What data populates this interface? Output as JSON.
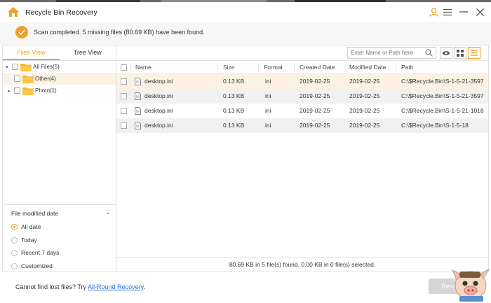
{
  "app": {
    "title": "Recycle Bin Recovery",
    "accent_color": "#f0a12a"
  },
  "titlebar": {
    "icons": [
      "home-icon",
      "user-icon",
      "menu-icon",
      "close-icon"
    ]
  },
  "status": {
    "message": "Scan completed. 5 missing files (80.69 KB) have been found."
  },
  "sidebar": {
    "tabs": [
      {
        "label": "Files View"
      },
      {
        "label": "Tree View"
      }
    ],
    "tree": [
      {
        "label": "All Files(5)"
      },
      {
        "label": "Other(4)"
      },
      {
        "label": "Photo(1)"
      }
    ]
  },
  "filter": {
    "heading": "File modified date",
    "options": [
      {
        "label": "All date",
        "selected": true
      },
      {
        "label": "Today",
        "selected": false
      },
      {
        "label": "Recent 7 days",
        "selected": false
      },
      {
        "label": "Customized",
        "selected": false
      }
    ]
  },
  "search": {
    "placeholder": "Enter Name or Path here"
  },
  "table": {
    "columns": [
      "Name",
      "Size",
      "Format",
      "Created Date",
      "Modified Date",
      "Path"
    ],
    "rows": [
      {
        "name": "desktop.ini",
        "size": "0.13 KB",
        "format": "ini",
        "created": "2019-02-25",
        "modified": "2019-02-25",
        "path": "C:\\$Recycle.Bin\\S-1-5-21-3597"
      },
      {
        "name": "desktop.ini",
        "size": "0.13 KB",
        "format": "ini",
        "created": "2019-02-25",
        "modified": "2019-02-25",
        "path": "C:\\$Recycle.Bin\\S-1-5-21-3597"
      },
      {
        "name": "desktop.ini",
        "size": "0.13 KB",
        "format": "ini",
        "created": "2019-02-25",
        "modified": "2019-02-25",
        "path": "C:\\$Recycle.Bin\\S-1-5-21-1018"
      },
      {
        "name": "desktop.ini",
        "size": "0.13 KB",
        "format": "ini",
        "created": "2019-02-25",
        "modified": "2019-02-25",
        "path": "C:\\$Recycle.Bin\\S-1-5-18"
      }
    ],
    "footer": "80.69 KB in 5 file(s) found. 0.00 KB in 0 file(s) selected."
  },
  "bottom": {
    "prompt": "Cannot find lost files? Try ",
    "link": "All-Round Recovery",
    "link_suffix": ".",
    "recover_label": "Reco"
  }
}
